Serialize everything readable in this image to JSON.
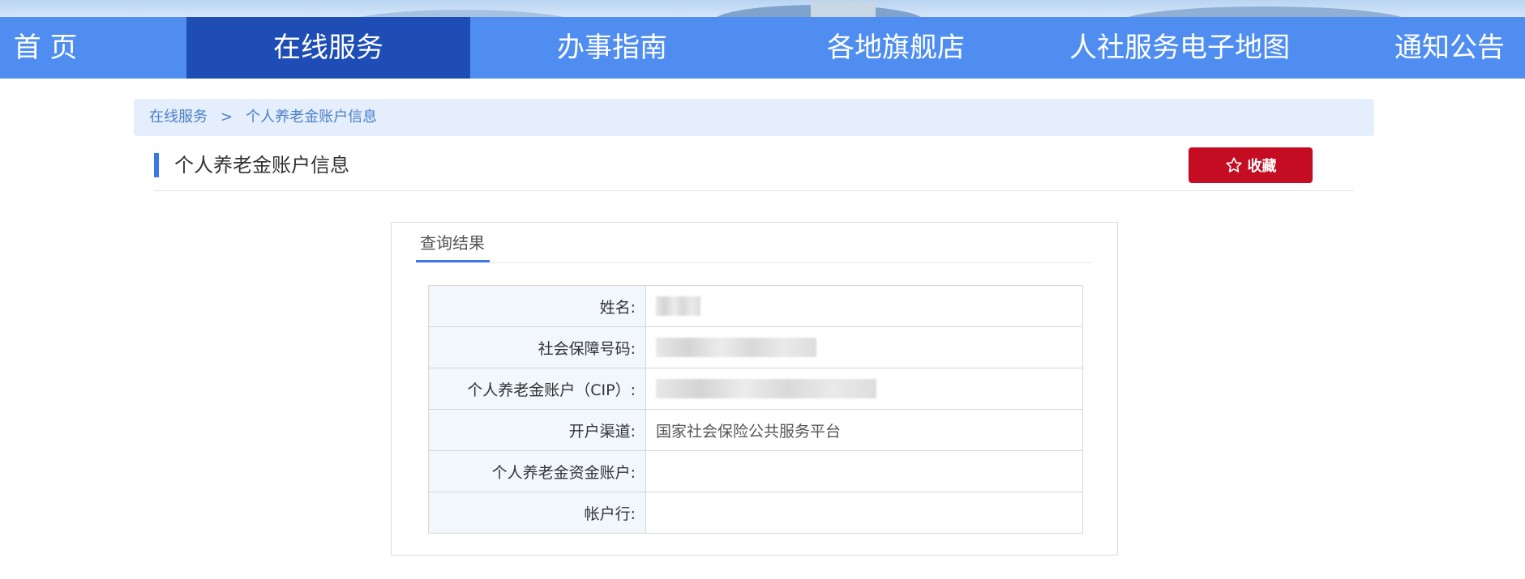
{
  "nav": {
    "items": [
      {
        "label": "首 页"
      },
      {
        "label": "在线服务"
      },
      {
        "label": "办事指南"
      },
      {
        "label": "各地旗舰店"
      },
      {
        "label": "人社服务电子地图"
      },
      {
        "label": "通知公告"
      }
    ],
    "active_index": 1
  },
  "breadcrumb": {
    "items": [
      "在线服务",
      "个人养老金账户信息"
    ],
    "separator": ">"
  },
  "page": {
    "title": "个人养老金账户信息",
    "favorite_label": "收藏"
  },
  "panel": {
    "tab_label": "查询结果",
    "rows": [
      {
        "label": "姓名:",
        "value": "",
        "redacted": true
      },
      {
        "label": "社会保障号码:",
        "value": "",
        "redacted": true
      },
      {
        "label": "个人养老金账户（CIP）:",
        "value": "",
        "redacted": true
      },
      {
        "label": "开户渠道:",
        "value": "国家社会保险公共服务平台",
        "redacted": false
      },
      {
        "label": "个人养老金资金账户:",
        "value": "",
        "redacted": false
      },
      {
        "label": "帐户行:",
        "value": "",
        "redacted": false
      }
    ]
  },
  "colors": {
    "nav_bg": "#4f8ef0",
    "nav_active_bg": "#1d4db5",
    "favorite_bg": "#c40d22",
    "accent": "#3b78e7",
    "breadcrumb_bg": "#e5eefc"
  },
  "icons": {
    "favorite": "star-outline-icon"
  }
}
